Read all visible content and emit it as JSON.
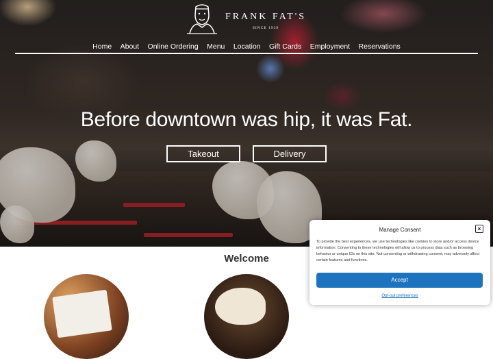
{
  "logo": {
    "name": "FRANK FAT'S",
    "since": "SINCE 1939"
  },
  "nav": {
    "items": [
      {
        "label": "Home"
      },
      {
        "label": "About"
      },
      {
        "label": "Online Ordering"
      },
      {
        "label": "Menu"
      },
      {
        "label": "Location"
      },
      {
        "label": "Gift Cards"
      },
      {
        "label": "Employment"
      },
      {
        "label": "Reservations"
      }
    ]
  },
  "hero": {
    "headline": "Before downtown was hip, it was Fat.",
    "takeout_label": "Takeout",
    "delivery_label": "Delivery"
  },
  "welcome": {
    "heading": "Welcome"
  },
  "consent": {
    "title": "Manage Consent",
    "close_icon": "close-icon",
    "body": "To provide the best experiences, we use technologies like cookies to store and/or access device information. Consenting to these technologies will allow us to process data such as browsing behavior or unique IDs on this site. Not consenting or withdrawing consent, may adversely affect certain features and functions.",
    "accept_label": "Accept",
    "optout_label": "Opt-out preferences",
    "accent_color": "#1e73be"
  }
}
